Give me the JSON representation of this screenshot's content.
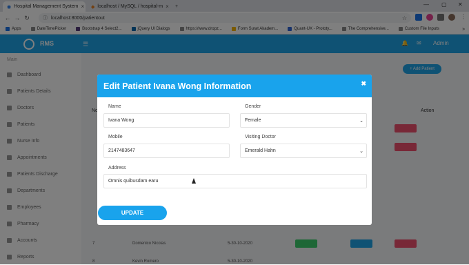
{
  "browser": {
    "tabs": [
      {
        "title": "Hospital Management System"
      },
      {
        "title": "localhost / MySQL / hospital-m"
      }
    ],
    "new_tab": "+",
    "url": "localhost:8000/patientout",
    "bookmarks": [
      "Apps",
      "DateTimePicker",
      "Bootstrap 4 Select2...",
      "jQuery UI Dialogs",
      "https://www.dropz...",
      "Form Surat Akadem...",
      "Quant-UX - Prototy...",
      "The Comprehensive...",
      "Custom File Inputs"
    ]
  },
  "app": {
    "brand": "RMS",
    "user": "Admin",
    "sidebar_heading": "Main",
    "sidebar_items": [
      "Dashboard",
      "Patients Details",
      "Doctors",
      "Patients",
      "Nurse Info",
      "Appointments",
      "Patients Discharge",
      "Departments",
      "Employees",
      "Pharmacy",
      "Accounts",
      "Reports"
    ],
    "add_button": "+ Add Patient",
    "table_action_header": "Action",
    "table_header_no": "No",
    "bg_rows": [
      {
        "no": "7",
        "name": "Domenico Nicolas",
        "date": "5-30-10-2020"
      },
      {
        "no": "8",
        "name": "Kevin Romero",
        "date": "5-30-10-2020"
      }
    ]
  },
  "modal": {
    "title": "Edit Patient Ivana Wong Information",
    "close": "✖",
    "fields": {
      "name_label": "Name",
      "name_value": "Ivana Wong",
      "gender_label": "Gender",
      "gender_value": "Female",
      "mobile_label": "Mobile",
      "mobile_value": "2147483647",
      "doctor_label": "Visiting Doctor",
      "doctor_value": "Emerald Hahn",
      "address_label": "Address",
      "address_value": "Omnis quibusdam earu"
    },
    "update_label": "UPDATE"
  },
  "colors": {
    "accent": "#19a3ec",
    "danger": "#f0506e",
    "success": "#3ccf6d"
  }
}
